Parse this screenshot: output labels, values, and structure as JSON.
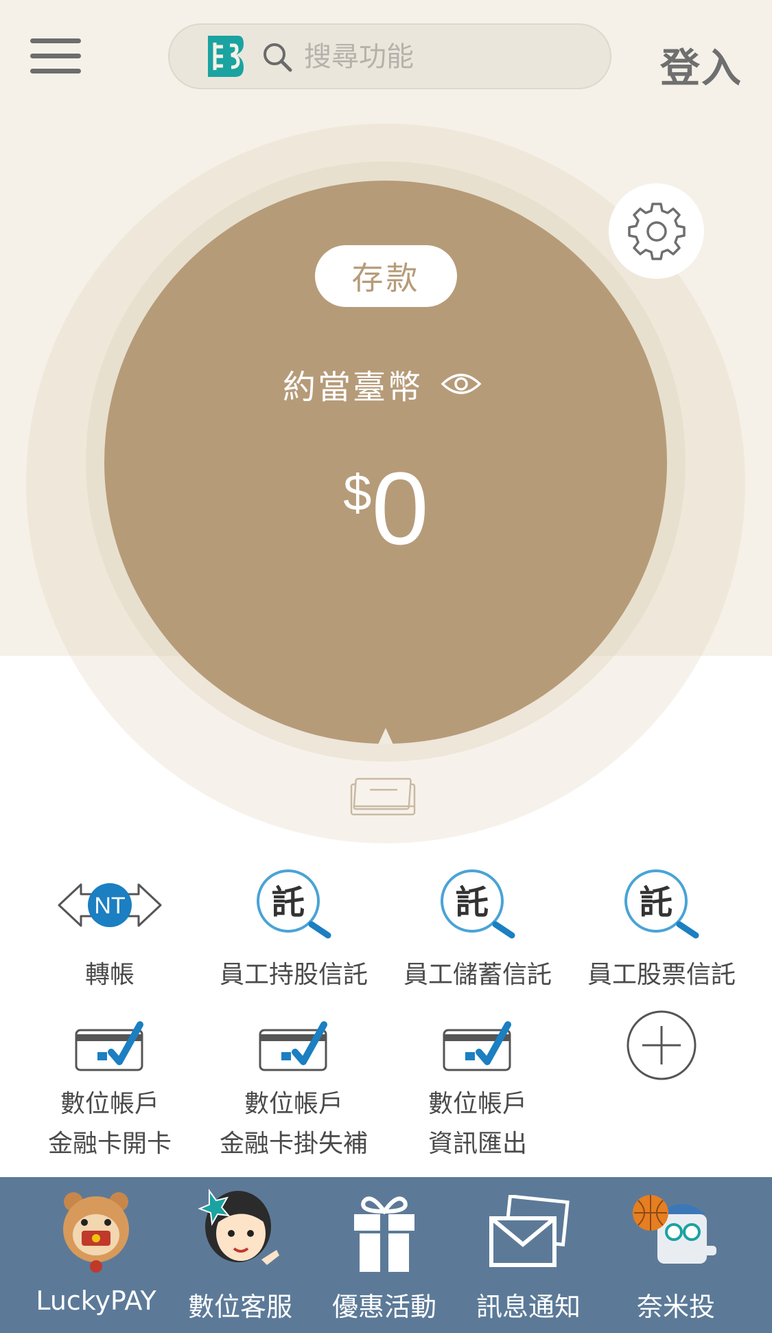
{
  "header": {
    "search_placeholder": "搜尋功能",
    "login_label": "登入",
    "brand_color": "#1aa3a0"
  },
  "balance": {
    "tab_label": "存款",
    "currency_label": "約當臺幣",
    "currency_symbol": "$",
    "amount": "0",
    "circle_color": "#b69b79"
  },
  "functions": [
    {
      "id": "transfer",
      "icon": "nt-transfer-icon",
      "label": "轉帳"
    },
    {
      "id": "employee-stock-ownership-trust",
      "icon": "trust-search-icon",
      "label": "員工持股信託"
    },
    {
      "id": "employee-savings-trust",
      "icon": "trust-search-icon",
      "label": "員工儲蓄信託"
    },
    {
      "id": "employee-stock-trust",
      "icon": "trust-search-icon",
      "label": "員工股票信託"
    },
    {
      "id": "digital-card-open",
      "icon": "card-check-icon",
      "label_line1": "數位帳戶",
      "label_line2": "金融卡開卡"
    },
    {
      "id": "digital-card-lost",
      "icon": "card-check-icon",
      "label_line1": "數位帳戶",
      "label_line2": "金融卡掛失補"
    },
    {
      "id": "digital-info-export",
      "icon": "card-check-icon",
      "label_line1": "數位帳戶",
      "label_line2": "資訊匯出"
    },
    {
      "id": "add-function",
      "icon": "plus-circle-icon"
    }
  ],
  "trust_char": "託",
  "nt_badge": "NT",
  "bottom_nav": [
    {
      "id": "luckypay",
      "label": "LuckyPAY",
      "icon": "bear-mascot-icon"
    },
    {
      "id": "digital-service",
      "label": "數位客服",
      "icon": "service-girl-icon"
    },
    {
      "id": "promotions",
      "label": "優惠活動",
      "icon": "gift-icon"
    },
    {
      "id": "notifications",
      "label": "訊息通知",
      "icon": "mail-icon"
    },
    {
      "id": "nano-invest",
      "label": "奈米投",
      "icon": "robo-advisor-icon"
    }
  ],
  "colors": {
    "top_background": "#f5f1e8",
    "nav_background": "#5c7a98",
    "icon_blue": "#1b7fc1",
    "trust_ring": "#4aa3d6"
  }
}
